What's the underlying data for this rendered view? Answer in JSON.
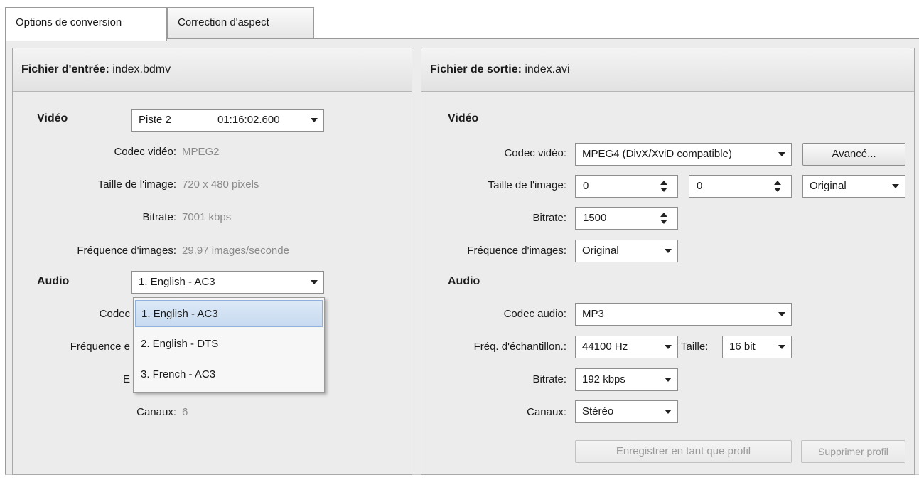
{
  "tabs": {
    "conversion": "Options de conversion",
    "aspect": "Correction d'aspect"
  },
  "input": {
    "header_label": "Fichier d'entrée:",
    "header_file": "index.bdmv",
    "video_section": "Vidéo",
    "video_track": "Piste 2",
    "video_duration": "01:16:02.600",
    "codec_label": "Codec vidéo:",
    "codec_value": "MPEG2",
    "size_label": "Taille de l'image:",
    "size_value": "720 x 480 pixels",
    "bitrate_label": "Bitrate:",
    "bitrate_value": "7001 kbps",
    "fps_label": "Fréquence d'images:",
    "fps_value": "29.97 images/seconde",
    "audio_section": "Audio",
    "audio_selected": "1. English - AC3",
    "audio_codec_label": "Codec",
    "audio_freq_label": "Fréquence e",
    "audio_bitrate_label": "E",
    "channels_label": "Canaux:",
    "channels_value": "6",
    "audio_options": [
      "1. English - AC3",
      "2. English - DTS",
      "3. French - AC3"
    ]
  },
  "output": {
    "header_label": "Fichier de sortie:",
    "header_file": "index.avi",
    "video_section": "Vidéo",
    "codec_label": "Codec vidéo:",
    "codec_value": "MPEG4 (DivX/XviD compatible)",
    "advanced_button": "Avancé...",
    "size_label": "Taille de l'image:",
    "width_value": "0",
    "height_value": "0",
    "size_mode": "Original",
    "bitrate_label": "Bitrate:",
    "bitrate_value": "1500",
    "fps_label": "Fréquence d'images:",
    "fps_value": "Original",
    "audio_section": "Audio",
    "audio_codec_label": "Codec audio:",
    "audio_codec_value": "MP3",
    "sample_label": "Fréq. d'échantillon.:",
    "sample_value": "44100 Hz",
    "sample_size_label": "Taille:",
    "sample_size_value": "16 bit",
    "audio_bitrate_label": "Bitrate:",
    "audio_bitrate_value": "192 kbps",
    "channels_label": "Canaux:",
    "channels_value": "Stéréo",
    "save_profile_button": "Enregistrer en tant que profil",
    "delete_profile_button": "Supprimer profil"
  }
}
